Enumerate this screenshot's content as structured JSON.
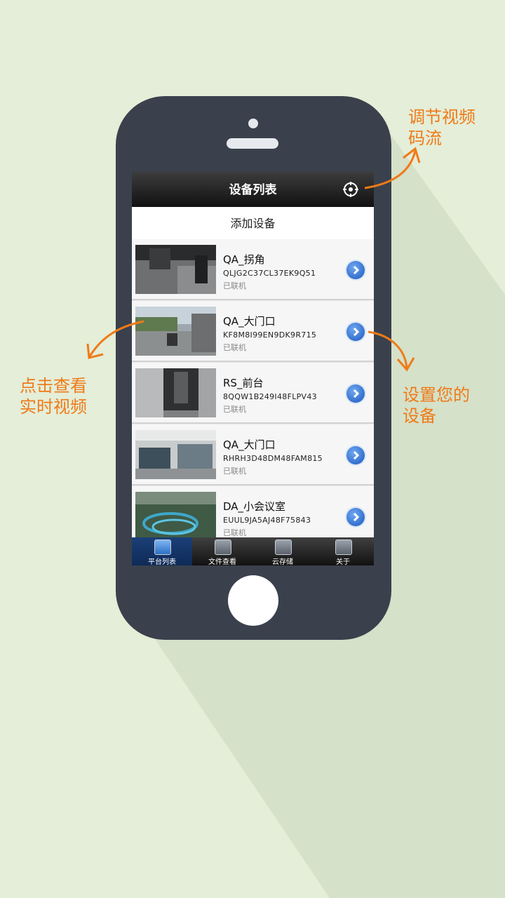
{
  "screen": {
    "title": "设备列表",
    "add_device": "添加设备"
  },
  "devices": [
    {
      "name": "QA_拐角",
      "serial": "QLJG2C37CL37EK9Q51",
      "status": "已联机"
    },
    {
      "name": "QA_大门口",
      "serial": "KF8M8I99EN9DK9R715",
      "status": "已联机"
    },
    {
      "name": "RS_前台",
      "serial": "8QQW1B249I48FLPV43",
      "status": "已联机"
    },
    {
      "name": "QA_大门口",
      "serial": "RHRH3D48DM48FAM815",
      "status": "已联机"
    },
    {
      "name": "DA_小会议室",
      "serial": "EUUL9JA5AJ48F75843",
      "status": "已联机"
    }
  ],
  "tabs": [
    {
      "label": "平台列表",
      "active": true
    },
    {
      "label": "文件查看",
      "active": false
    },
    {
      "label": "云存储",
      "active": false
    },
    {
      "label": "关于",
      "active": false
    }
  ],
  "annotations": {
    "stream_line1": "调节视频",
    "stream_line2": "码流",
    "view_line1": "点击查看",
    "view_line2": "实时视频",
    "settings_line1": "设置您的",
    "settings_line2": "设备"
  },
  "colors": {
    "background": "#e4eed8",
    "phone": "#3a414c",
    "annotation": "#f07a18",
    "accent": "#1b58c0"
  }
}
